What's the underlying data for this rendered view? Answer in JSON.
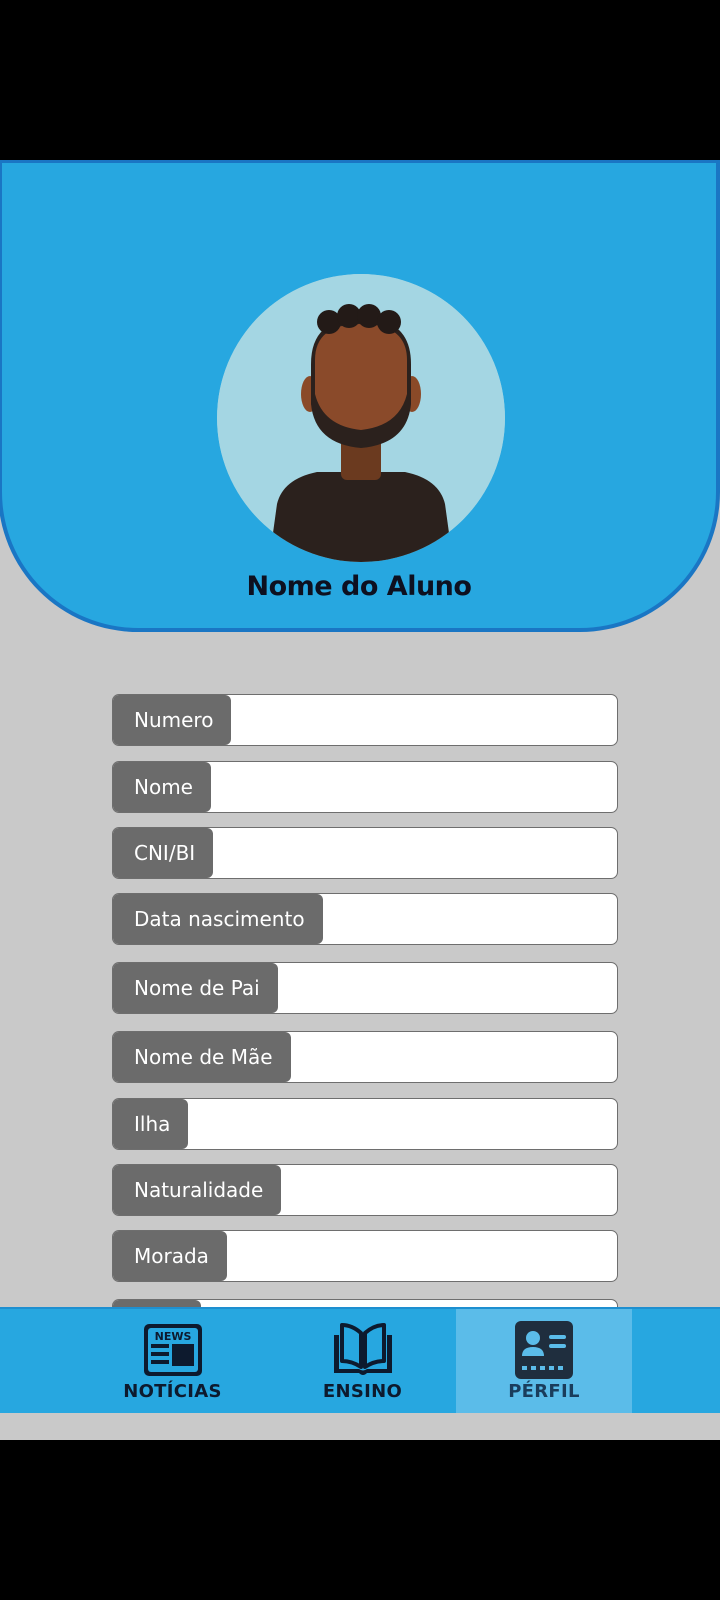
{
  "profile": {
    "student_name": "Nome do Aluno"
  },
  "fields": [
    {
      "label": "Numero",
      "value": ""
    },
    {
      "label": "Nome",
      "value": ""
    },
    {
      "label": "CNI/BI",
      "value": ""
    },
    {
      "label": "Data nascimento",
      "value": ""
    },
    {
      "label": "Nome de Pai",
      "value": ""
    },
    {
      "label": "Nome de Mãe",
      "value": ""
    },
    {
      "label": "Ilha",
      "value": ""
    },
    {
      "label": "Naturalidade",
      "value": ""
    },
    {
      "label": "Morada",
      "value": ""
    },
    {
      "label": "",
      "value": ""
    }
  ],
  "nav": {
    "items": [
      {
        "label": "NOTÍCIAS",
        "icon": "newspaper-icon",
        "icon_text": "NEWS",
        "active": false
      },
      {
        "label": "ENSINO",
        "icon": "book-icon",
        "active": false
      },
      {
        "label": "PÉRFIL",
        "icon": "id-card-icon",
        "active": true
      }
    ]
  },
  "colors": {
    "header_bg": "#27a7e0",
    "screen_bg": "#c9c9c9",
    "label_bg": "#6b6b6b",
    "nav_active": "#5bbce9"
  }
}
